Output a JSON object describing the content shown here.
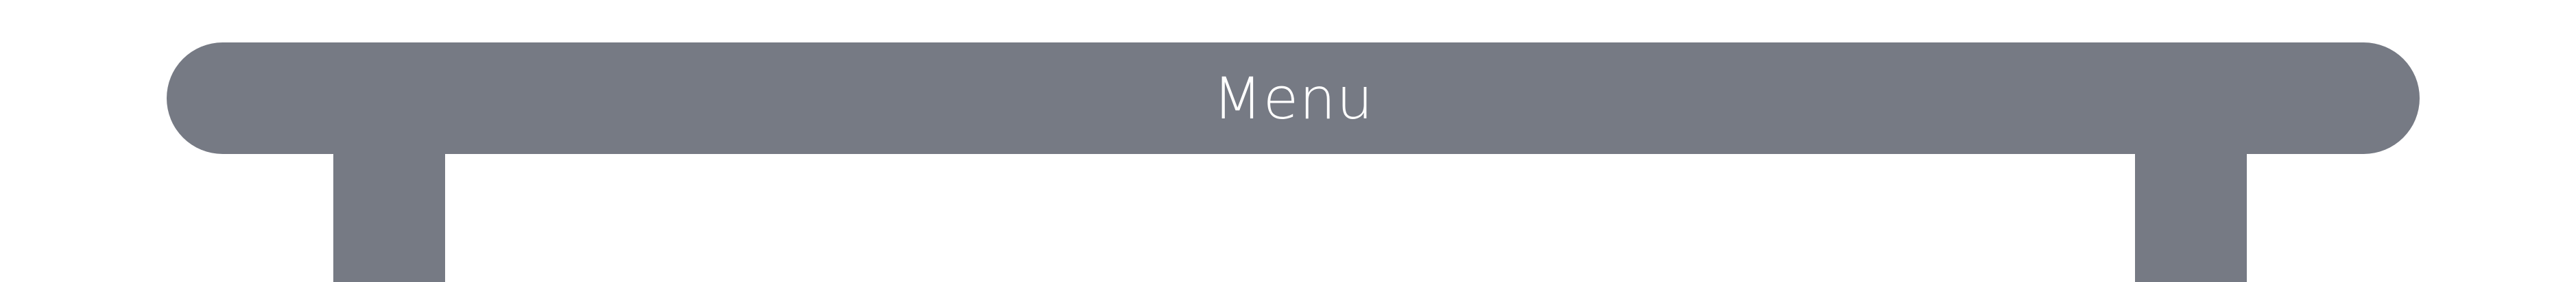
{
  "menu": {
    "title": "Menu"
  },
  "colors": {
    "bar": "#767a84",
    "title_text": "#ffffff",
    "background": "#ffffff"
  }
}
